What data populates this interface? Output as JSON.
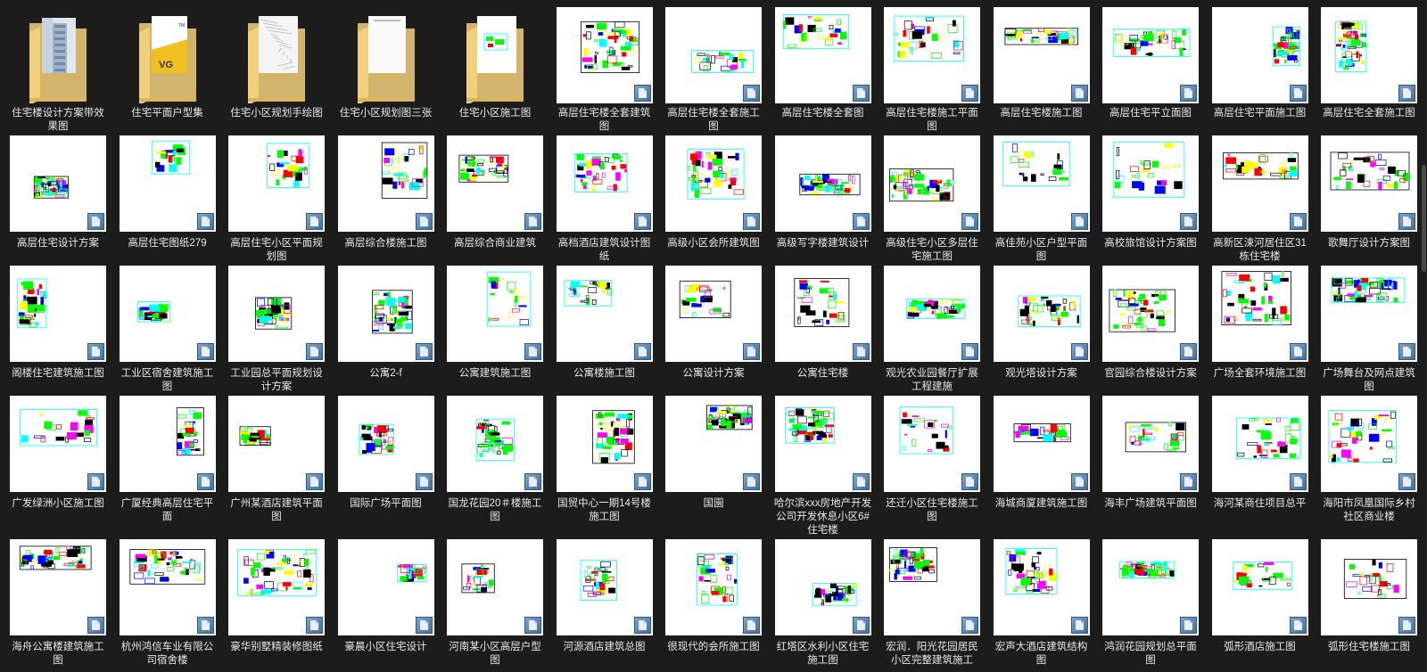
{
  "items": [
    {
      "type": "folder",
      "name": "住宅楼设计方案带效果图",
      "art": "building"
    },
    {
      "type": "folder",
      "name": "住宅平面户型集",
      "art": "yellowdoc"
    },
    {
      "type": "folder",
      "name": "住宅小区规划手绘图",
      "art": "sketch"
    },
    {
      "type": "folder",
      "name": "住宅小区规划图三张",
      "art": "paper"
    },
    {
      "type": "folder",
      "name": "住宅小区施工图",
      "art": "cad"
    },
    {
      "type": "file",
      "name": "高层住宅楼全套建筑图"
    },
    {
      "type": "file",
      "name": "高层住宅楼全套施工图"
    },
    {
      "type": "file",
      "name": "高层住宅楼全套图"
    },
    {
      "type": "file",
      "name": "高层住宅楼施工平面图"
    },
    {
      "type": "file",
      "name": "高层住宅楼施工图"
    },
    {
      "type": "file",
      "name": "高层住宅平立面图"
    },
    {
      "type": "file",
      "name": "高层住宅平面施工图"
    },
    {
      "type": "file",
      "name": "高层住宅全套施工图"
    },
    {
      "type": "file",
      "name": "高层住宅设计方案"
    },
    {
      "type": "file",
      "name": "高层住宅图纸279"
    },
    {
      "type": "file",
      "name": "高层住宅小区平面规划图"
    },
    {
      "type": "file",
      "name": "高层综合楼施工图"
    },
    {
      "type": "file",
      "name": "高层综合商业建筑"
    },
    {
      "type": "file",
      "name": "高档酒店建筑设计图纸"
    },
    {
      "type": "file",
      "name": "高级小区会所建筑图"
    },
    {
      "type": "file",
      "name": "高级写字楼建筑设计"
    },
    {
      "type": "file",
      "name": "高级住宅小区多层住宅施工图"
    },
    {
      "type": "file",
      "name": "高佳苑小区户型平面图"
    },
    {
      "type": "file",
      "name": "高校旅馆设计方案图"
    },
    {
      "type": "file",
      "name": "高新区涑河居住区31栋住宅楼"
    },
    {
      "type": "file",
      "name": "歌舞厅设计方案图"
    },
    {
      "type": "file",
      "name": "阁楼住宅建筑施工图"
    },
    {
      "type": "file",
      "name": "工业区宿舍建筑施工图"
    },
    {
      "type": "file",
      "name": "工业园总平面规划设计方案"
    },
    {
      "type": "file",
      "name": "公寓2-f"
    },
    {
      "type": "file",
      "name": "公寓建筑施工图"
    },
    {
      "type": "file",
      "name": "公寓楼施工图"
    },
    {
      "type": "file",
      "name": "公寓设计方案"
    },
    {
      "type": "file",
      "name": "公寓住宅楼"
    },
    {
      "type": "file",
      "name": "观光农业园餐厅扩展工程建施"
    },
    {
      "type": "file",
      "name": "观光塔设计方案"
    },
    {
      "type": "file",
      "name": "官园综合楼设计方案"
    },
    {
      "type": "file",
      "name": "广场全套环境施工图"
    },
    {
      "type": "file",
      "name": "广场舞台及网点建筑图"
    },
    {
      "type": "file",
      "name": "广发绿洲小区施工图"
    },
    {
      "type": "file",
      "name": "广厦经典高层住宅平面"
    },
    {
      "type": "file",
      "name": "广州某酒店建筑平面图"
    },
    {
      "type": "file",
      "name": "国际广场平面图"
    },
    {
      "type": "file",
      "name": "国龙花园20＃楼施工图"
    },
    {
      "type": "file",
      "name": "国贸中心一期14号楼施工图"
    },
    {
      "type": "file",
      "name": "国園"
    },
    {
      "type": "file",
      "name": "哈尔滨xxx房地产开发公司开发休息小区6#住宅楼"
    },
    {
      "type": "file",
      "name": "还迁小区住宅楼施工图"
    },
    {
      "type": "file",
      "name": "海城商厦建筑施工图"
    },
    {
      "type": "file",
      "name": "海丰广场建筑平面图"
    },
    {
      "type": "file",
      "name": "海河某商住项目总平"
    },
    {
      "type": "file",
      "name": "海阳市凤凰国际乡村社区商业楼"
    },
    {
      "type": "file",
      "name": "海舟公寓楼建筑施工图"
    },
    {
      "type": "file",
      "name": "杭州鸿信车业有限公司宿舍楼"
    },
    {
      "type": "file",
      "name": "豪华别墅精装修图纸"
    },
    {
      "type": "file",
      "name": "豪晨小区住宅设计"
    },
    {
      "type": "file",
      "name": "河南某小区高层户型图"
    },
    {
      "type": "file",
      "name": "河源酒店建筑总图"
    },
    {
      "type": "file",
      "name": "很现代的会所施工图"
    },
    {
      "type": "file",
      "name": "红塔区水利小区住宅施工图"
    },
    {
      "type": "file",
      "name": "宏润．阳光花园居民小区完整建筑施工"
    },
    {
      "type": "file",
      "name": "宏声大酒店建筑结构图"
    },
    {
      "type": "file",
      "name": "鸿润花园规划总平面图"
    },
    {
      "type": "file",
      "name": "弧形酒店施工图"
    },
    {
      "type": "file",
      "name": "弧形住宅楼施工图"
    }
  ],
  "colors": {
    "background": "#1c1c1c",
    "folder": "#f2cf7a",
    "cad_primary": "#00ff00",
    "cad_frame": "#00ffff",
    "label": "#e8e8e8"
  },
  "icons": {
    "file_badge": "document-icon",
    "folder": "folder-icon"
  }
}
